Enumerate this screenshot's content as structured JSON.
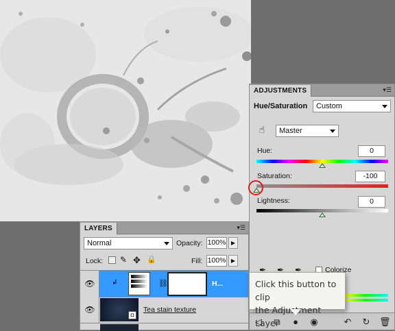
{
  "adjustments": {
    "tab_label": "ADJUSTMENTS",
    "menu_icon": "panel-menu-icon",
    "title": "Hue/Saturation",
    "preset_value": "Custom",
    "channel_value": "Master",
    "hue": {
      "label": "Hue:",
      "value": "0",
      "fraction": 0.5
    },
    "saturation": {
      "label": "Saturation:",
      "value": "-100",
      "fraction": 0.0
    },
    "lightness": {
      "label": "Lightness:",
      "value": "0",
      "fraction": 0.5
    },
    "colorize_label": "Colorize",
    "colorize_checked": false,
    "bottom_icons": [
      "back-arrow-icon",
      "expand-view-icon",
      "clip-layer-icon",
      "visibility-eye-icon",
      "previous-state-icon",
      "reset-icon",
      "delete-icon"
    ]
  },
  "layers": {
    "tab_label": "LAYERS",
    "blend_mode": "Normal",
    "opacity_label": "Opacity:",
    "opacity_value": "100%",
    "lock_label": "Lock:",
    "fill_label": "Fill:",
    "fill_value": "100%",
    "rows": [
      {
        "name": "H...",
        "selected": true
      },
      {
        "name": "Tea stain texture",
        "selected": false
      }
    ]
  },
  "tooltip": {
    "line1": "Click this button to clip",
    "line2": "the Adjustment Layer"
  },
  "colors": {
    "selected_row": "#3399ff",
    "highlight_circle": "#e01b1b",
    "panel_bg": "#d6d6d6"
  }
}
